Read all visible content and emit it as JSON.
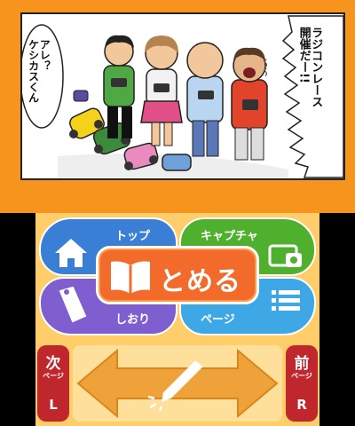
{
  "comic": {
    "speech_left_lines": [
      "アレ？",
      "ケシカスくん"
    ],
    "speech_right_lines": [
      "ラジコンレース",
      "開催だー!!"
    ],
    "sound_wiggle": "〜〜"
  },
  "menu": {
    "top_label": "トップ",
    "capture_label": "キャプチャ",
    "bookmark_label": "しおり",
    "page_label": "ページ",
    "close_label": "とめる"
  },
  "controls": {
    "next": {
      "main": "次",
      "sub": "ページ",
      "key": "L"
    },
    "prev": {
      "main": "前",
      "sub": "ページ",
      "key": "R"
    }
  },
  "icons": {
    "top": "home-icon",
    "capture": "camera-icon",
    "bookmark": "bookmark-tag-icon",
    "page": "list-icon",
    "close": "open-book-icon",
    "swipe": "stylus-icon"
  },
  "colors": {
    "top_screen_bg": "#f7941d",
    "top_button": "#3a7fd6",
    "capture_button": "#4fb02e",
    "bookmark_button": "#7f5fd0",
    "page_button": "#3ea7e6",
    "close_button": "#f36b2b",
    "side_buttons": "#c0272d"
  }
}
